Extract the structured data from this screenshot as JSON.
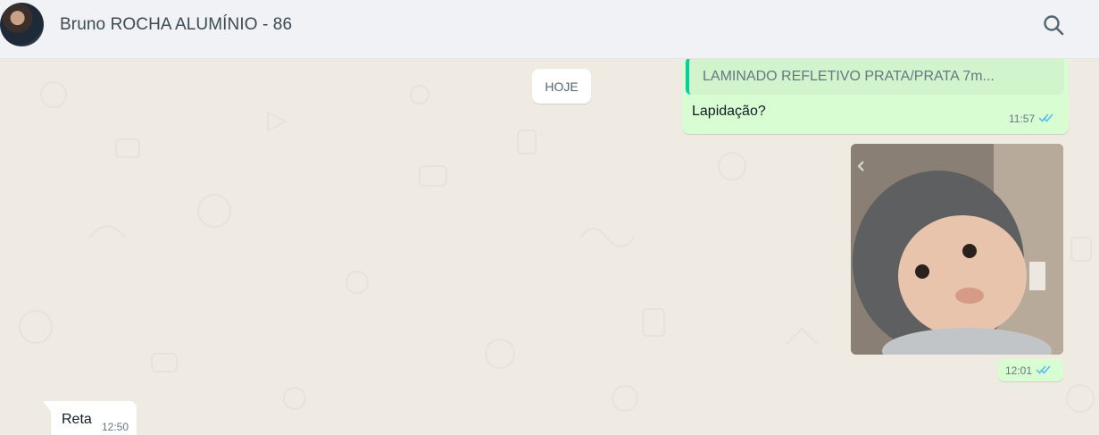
{
  "header": {
    "contact_name": "Bruno ROCHA ALUMÍNIO - 86",
    "search_icon": "search-icon"
  },
  "chat": {
    "date_separator": "HOJE",
    "messages": [
      {
        "direction": "outgoing",
        "quoted_text": "LAMINADO REFLETIVO PRATA/PRATA 7m...",
        "text": "Lapidação?",
        "time": "11:57",
        "status": "read"
      },
      {
        "direction": "outgoing",
        "type": "image",
        "time": "12:01",
        "status": "read"
      },
      {
        "direction": "incoming",
        "text": "Reta",
        "time": "12:50"
      }
    ]
  },
  "colors": {
    "header_bg": "#f0f2f5",
    "chat_bg": "#efeae2",
    "outgoing_bubble": "#d9fdd3",
    "incoming_bubble": "#ffffff",
    "quote_accent": "#06cf9c",
    "read_tick": "#53bdeb"
  }
}
